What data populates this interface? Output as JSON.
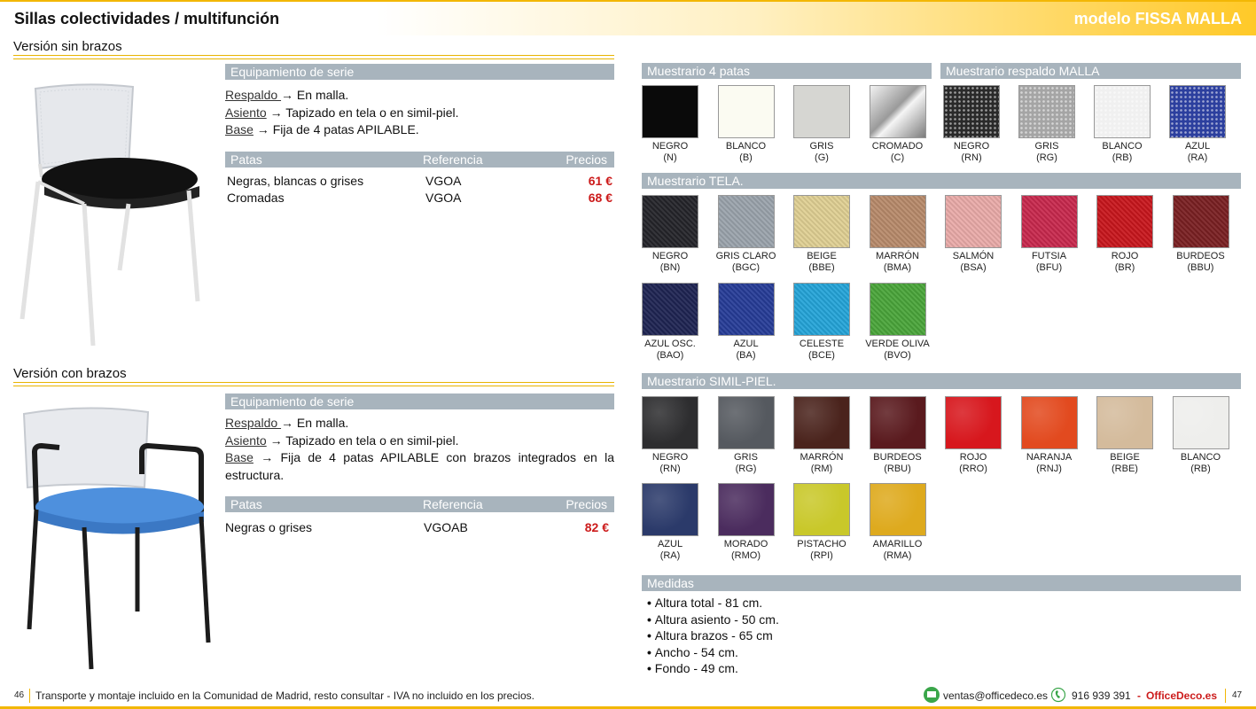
{
  "header": {
    "title": "Sillas colectividades / multifunción",
    "model": "modelo FISSA MALLA"
  },
  "sin_brazos": {
    "title": "Versión sin brazos",
    "equip_title": "Equipamiento de serie",
    "specs": [
      {
        "k": "Respaldo ",
        "v": "→ En malla."
      },
      {
        "k": "Asiento",
        "v": " → Tapizado en tela o en simil-piel."
      },
      {
        "k": "Base",
        "v": " → Fija de 4 patas APILABLE."
      }
    ],
    "table": {
      "h1": "Patas",
      "h2": "Referencia",
      "h3": "Precios",
      "rows": [
        {
          "a": "Negras, blancas o grises",
          "b": "VGOA",
          "c": "61 €"
        },
        {
          "a": "Cromadas",
          "b": "VGOA",
          "c": "68 €"
        }
      ]
    }
  },
  "con_brazos": {
    "title": "Versión con brazos",
    "equip_title": "Equipamiento de serie",
    "specs": [
      {
        "k": "Respaldo ",
        "v": "→ En malla."
      },
      {
        "k": "Asiento",
        "v": " → Tapizado en tela o en simil-piel."
      },
      {
        "k": "Base",
        "v": " → Fija de 4 patas APILABLE con brazos integrados en la estructura."
      }
    ],
    "table": {
      "h1": "Patas",
      "h2": "Referencia",
      "h3": "Precios",
      "rows": [
        {
          "a": "Negras o grises",
          "b": "VGOAB",
          "c": "82 €"
        }
      ]
    }
  },
  "m4patas": {
    "title": "Muestrario 4 patas",
    "items": [
      {
        "name": "NEGRO",
        "code": "(N)",
        "color": "#0a0a0a"
      },
      {
        "name": "BLANCO",
        "code": "(B)",
        "color": "#fbfbf2"
      },
      {
        "name": "GRIS",
        "code": "(G)",
        "color": "#d6d6d2"
      },
      {
        "name": "CROMADO",
        "code": "(C)",
        "color": "#c9c9c9"
      }
    ]
  },
  "mmalla": {
    "title": "Muestrario respaldo MALLA",
    "items": [
      {
        "name": "NEGRO",
        "code": "(RN)",
        "color": "#2a2a2a"
      },
      {
        "name": "GRIS",
        "code": "(RG)",
        "color": "#a5a5a5"
      },
      {
        "name": "BLANCO",
        "code": "(RB)",
        "color": "#f0f0f0"
      },
      {
        "name": "AZUL",
        "code": "(RA)",
        "color": "#2c3f9e"
      }
    ]
  },
  "mtela": {
    "title": "Muestrario TELA.",
    "items": [
      {
        "name": "NEGRO",
        "code": "(BN)",
        "color": "#242429"
      },
      {
        "name": "GRIS CLARO",
        "code": "(BGC)",
        "color": "#9aa3ab"
      },
      {
        "name": "BEIGE",
        "code": "(BBE)",
        "color": "#dfcf93"
      },
      {
        "name": "MARRÓN",
        "code": "(BMA)",
        "color": "#b78a6a"
      },
      {
        "name": "SALMÓN",
        "code": "(BSA)",
        "color": "#e9aaa8"
      },
      {
        "name": "FUTSIA",
        "code": "(BFU)",
        "color": "#c8284d"
      },
      {
        "name": "ROJO",
        "code": "(BR)",
        "color": "#c8161c"
      },
      {
        "name": "BURDEOS",
        "code": "(BBU)",
        "color": "#7a1f22"
      },
      {
        "name": "AZUL OSC.",
        "code": "(BAO)",
        "color": "#1e2452"
      },
      {
        "name": "AZUL",
        "code": "(BA)",
        "color": "#263c97"
      },
      {
        "name": "CELESTE",
        "code": "(BCE)",
        "color": "#24a4d8"
      },
      {
        "name": "VERDE OLIVA",
        "code": "(BVO)",
        "color": "#4aa53a"
      }
    ]
  },
  "mpiel": {
    "title": "Muestrario SIMIL-PIEL.",
    "items": [
      {
        "name": "NEGRO",
        "code": "(RN)",
        "color": "#2d2d2f"
      },
      {
        "name": "GRIS",
        "code": "(RG)",
        "color": "#55595f"
      },
      {
        "name": "MARRÓN",
        "code": "(RM)",
        "color": "#4a231c"
      },
      {
        "name": "BURDEOS",
        "code": "(RBU)",
        "color": "#5a1a1e"
      },
      {
        "name": "ROJO",
        "code": "(RRO)",
        "color": "#d7171d"
      },
      {
        "name": "NARANJA",
        "code": "(RNJ)",
        "color": "#e24a1f"
      },
      {
        "name": "BEIGE",
        "code": "(RBE)",
        "color": "#d4bb9c"
      },
      {
        "name": "BLANCO",
        "code": "(RB)",
        "color": "#eeeeec"
      },
      {
        "name": "AZUL",
        "code": "(RA)",
        "color": "#2b3a6a"
      },
      {
        "name": "MORADO",
        "code": "(RMO)",
        "color": "#4b2c5e"
      },
      {
        "name": "PISTACHO",
        "code": "(RPI)",
        "color": "#c9c82a"
      },
      {
        "name": "AMARILLO",
        "code": "(RMA)",
        "color": "#deaa1e"
      }
    ]
  },
  "medidas": {
    "title": "Medidas",
    "items": [
      "Altura total - 81 cm.",
      "Altura asiento - 50 cm.",
      "Altura brazos - 65 cm",
      "Ancho - 54 cm.",
      "Fondo - 49 cm."
    ]
  },
  "footer": {
    "page_left": "46",
    "note": "Transporte y montaje incluido en la Comunidad de Madrid, resto consultar - IVA no incluido en los precios.",
    "email": "ventas@officedeco.es",
    "phone": "916 939 391",
    "sep": "-",
    "brand": "OfficeDeco.es",
    "page_right": "47"
  }
}
